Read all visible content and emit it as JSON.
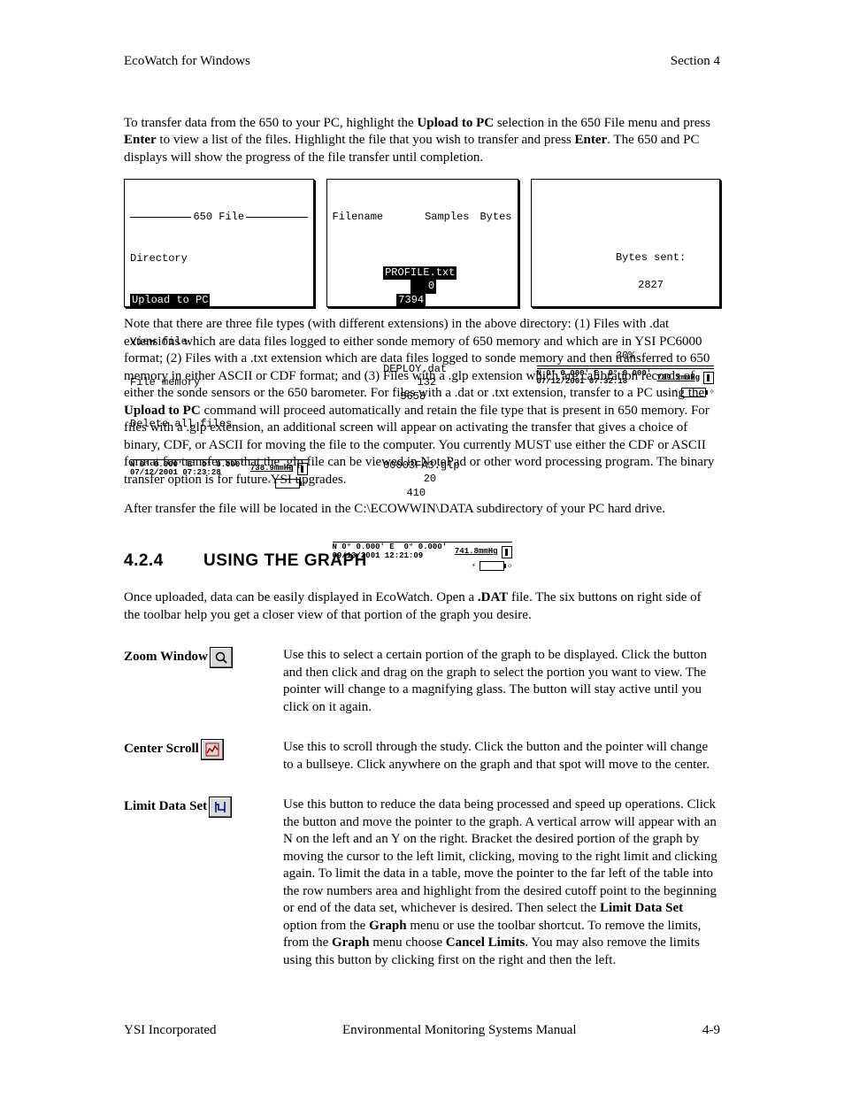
{
  "header": {
    "left": "EcoWatch for Windows",
    "right": "Section 4"
  },
  "intro": {
    "t1": "To transfer data from the 650 to your PC, highlight the ",
    "b1": "Upload to PC",
    "t2": " selection in the 650 File menu and press ",
    "b2": "Enter",
    "t3": " to view a list of the files.  Highlight the file that you wish to transfer and press ",
    "b3": "Enter",
    "t4": ".  The 650 and PC displays will show the progress of the file transfer until completion."
  },
  "panel1": {
    "title": "650 File",
    "items": [
      "Directory",
      "Upload to PC",
      "View file",
      "File memory",
      "Delete all files"
    ],
    "selectedIndex": 1,
    "coord1": "N 0° 0.000' E  0° 0.000'",
    "coord2": "07/12/2001 07:23:28",
    "pressure": "738.9mmHg"
  },
  "panel2": {
    "headers": [
      "Filename",
      "Samples",
      "Bytes"
    ],
    "rows": [
      {
        "name": "PROFILE.txt",
        "samples": "0",
        "bytes": "7394",
        "hl": true
      },
      {
        "name": "DEPLOY.dat",
        "samples": "132",
        "bytes": "5658"
      },
      {
        "name": "00003FA3.glp",
        "samples": "20",
        "bytes": "410"
      }
    ],
    "coord1": "N 0° 0.000' E  0° 0.000'",
    "coord2": "09/13/2001 12:21:09",
    "pressure": "741.8mmHg"
  },
  "panel3": {
    "label": "Bytes sent:",
    "value": "2827",
    "percent": "30%",
    "coord1": "N 0° 0.000' E  0° 0.000'",
    "coord2": "07/12/2001 07:32:18",
    "pressure": "739.2mmHg"
  },
  "para2": {
    "t1": "Note that there are three file types (with different extensions) in the above directory: (1) Files with .dat extensions which are data files logged to either sonde memory of 650 memory and which are in YSI PC6000 format; (2) Files with a .txt extension which are data files logged to sonde memory and then transferred to 650 memory in either ASCII or CDF format; and (3) Files with a .glp extension which are calibration records of either the sonde sensors or the 650 barometer.  For files with a .dat or .txt extension, transfer to a PC using the ",
    "b1": "Upload to PC",
    "t2": " command will proceed automatically and retain the file type that is present in 650 memory.  For files with a .glp extension, an additional screen will appear on activating the transfer that gives a choice of binary, CDF, or ASCII for moving the file to the computer.   You currently MUST use either the CDF or ASCII format for transfer so that the .glp file can be viewed in NotePad or other word processing program.  The binary transfer option is for future YSI upgrades."
  },
  "para3": "After transfer the file will be located in the C:\\ECOWWIN\\DATA subdirectory of your PC hard drive.",
  "section": {
    "num": "4.2.4",
    "title": "USING THE GRAPH"
  },
  "para4": {
    "t1": "Once uploaded, data can be easily displayed in EcoWatch. Open a ",
    "b1": ".DAT",
    "t2": " file. The six buttons on right side of the toolbar help you get a closer view of that portion of the graph you desire."
  },
  "tools": {
    "zoom": {
      "label": "Zoom Window",
      "desc": "Use this to select a certain portion of the graph to be displayed.  Click the button and then click and drag on the graph to select the portion you want to view.  The pointer will change to a magnifying glass.  The button will stay active until you click on it again."
    },
    "scroll": {
      "label": "Center Scroll",
      "desc": "Use this to scroll through the study.  Click the button and the pointer will change to a bullseye.  Click anywhere on the graph and that spot will move to the center."
    },
    "limit": {
      "label": "Limit Data Set",
      "d1": "Use this button to reduce the data being processed and speed up operations.  Click the button and move the pointer to the graph.  A vertical arrow will appear with an N on the left and an Y on the right.  Bracket the desired portion of the graph by moving the cursor to the left limit, clicking, moving to the right limit and clicking again.  To limit the data in a table, move the pointer to the far left of the table into the row numbers area and highlight from the desired cutoff point to the beginning or end of the data set, whichever is desired.  Then select the ",
      "b1": "Limit Data Set",
      "d2": " option from the ",
      "b2": "Graph",
      "d3": " menu or use the toolbar shortcut. To remove the limits, from the ",
      "b3": "Graph",
      "d4": " menu choose ",
      "b4": "Cancel Limits",
      "d5": ".  You may also remove the limits using this button by clicking first on the right and then the left."
    }
  },
  "footer": {
    "left": "YSI Incorporated",
    "center": "Environmental Monitoring Systems Manual",
    "right": "4-9"
  }
}
